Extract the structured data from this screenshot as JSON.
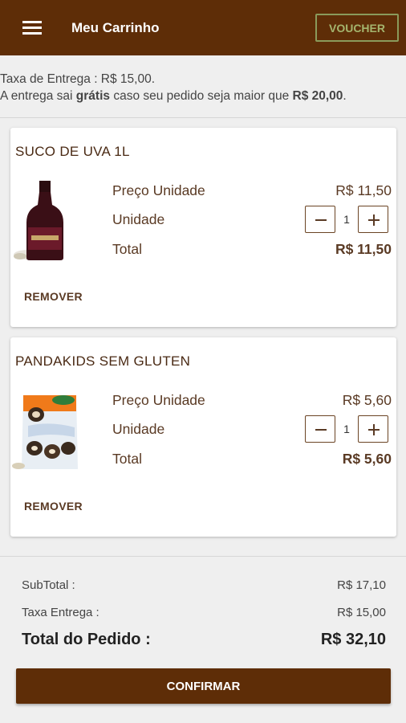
{
  "appbar": {
    "title": "Meu Carrinho",
    "menu_icon": "menu-icon",
    "voucher_label": "VOUCHER"
  },
  "delivery": {
    "fee_text": "Taxa de Entrega : R$ 15,00.",
    "free_prefix": "A entrega sai ",
    "free_word": "grátis",
    "free_middle": " caso seu pedido seja maior que ",
    "free_threshold": "R$ 20,00",
    "free_suffix": "."
  },
  "cart_items": [
    {
      "name": "SUCO DE UVA 1L",
      "image_icon": "grape-juice-bottle-image",
      "unit_price_label": "Preço Unidade",
      "unit_price": "R$ 11,50",
      "quantity_label": "Unidade",
      "quantity": "1",
      "total_label": "Total",
      "total": "R$ 11,50",
      "remove_label": "REMOVER"
    },
    {
      "name": "PANDAKIDS SEM GLUTEN",
      "image_icon": "pandakids-cookies-package-image",
      "unit_price_label": "Preço Unidade",
      "unit_price": "R$ 5,60",
      "quantity_label": "Unidade",
      "quantity": "1",
      "total_label": "Total",
      "total": "R$ 5,60",
      "remove_label": "REMOVER"
    }
  ],
  "summary": {
    "subtotal_label": "SubTotal :",
    "subtotal": "R$ 17,10",
    "delivery_label": "Taxa Entrega :",
    "delivery": "R$ 15,00",
    "order_total_label": "Total do Pedido :",
    "order_total": "R$ 32,10"
  },
  "confirm_label": "CONFIRMAR",
  "colors": {
    "primary": "#5e2d07",
    "voucher_border": "#8a9a5b",
    "background": "#efefef"
  }
}
